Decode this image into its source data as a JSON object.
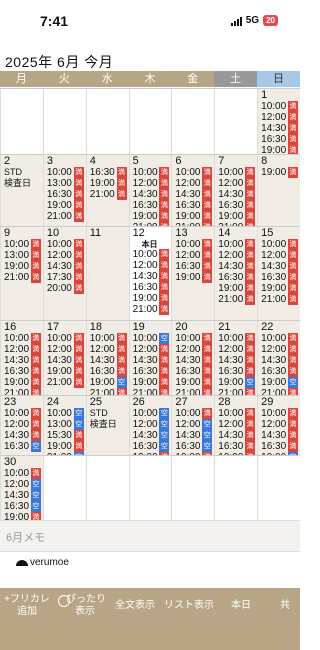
{
  "status_bar": {
    "time": "7:41",
    "network": "5G",
    "battery": "20"
  },
  "header": {
    "title": "2025年 6月 今月"
  },
  "weekdays": [
    "月",
    "火",
    "水",
    "木",
    "金",
    "土",
    "日"
  ],
  "badge_labels": {
    "red": "満",
    "blue": "空"
  },
  "today_label": "本日",
  "weeks": [
    [
      null,
      null,
      null,
      null,
      null,
      null,
      {
        "day": "1",
        "times": [
          "10:00",
          "12:00",
          "14:30",
          "16:30",
          "19:00",
          "21:00"
        ],
        "badges": [
          "red",
          "red",
          "red",
          "red",
          "red",
          "red"
        ]
      }
    ],
    [
      {
        "day": "2",
        "note": [
          "STD",
          "検査日"
        ],
        "times": [],
        "badges": []
      },
      {
        "day": "3",
        "times": [
          "10:00",
          "13:00",
          "16:30",
          "19:00",
          "21:00"
        ],
        "badges": [
          "red",
          "red",
          "red",
          "red",
          "red"
        ]
      },
      {
        "day": "4",
        "times": [
          "16:30",
          "19:00",
          "21:00"
        ],
        "badges": [
          "red",
          "red",
          "red"
        ]
      },
      {
        "day": "5",
        "times": [
          "10:00",
          "12:00",
          "14:30",
          "16:30",
          "19:00",
          "21:00"
        ],
        "badges": [
          "red",
          "red",
          "red",
          "red",
          "red",
          "red"
        ]
      },
      {
        "day": "6",
        "times": [
          "10:00",
          "12:00",
          "14:30",
          "16:30",
          "19:00",
          "21:00"
        ],
        "badges": [
          "red",
          "red",
          "red",
          "red",
          "red",
          "red"
        ]
      },
      {
        "day": "7",
        "times": [
          "10:00",
          "12:00",
          "14:30",
          "16:30",
          "19:00",
          "21:00"
        ],
        "badges": [
          "red",
          "red",
          "red",
          "red",
          "red",
          "red"
        ]
      },
      {
        "day": "8",
        "times": [
          "19:00"
        ],
        "badges": [
          "red"
        ]
      }
    ],
    [
      {
        "day": "9",
        "times": [
          "10:00",
          "13:00",
          "19:00",
          "21:00"
        ],
        "badges": [
          "red",
          "red",
          "red",
          "red"
        ]
      },
      {
        "day": "10",
        "times": [
          "10:00",
          "12:00",
          "14:30",
          "17:30",
          "20:00"
        ],
        "badges": [
          "red",
          "red",
          "red",
          "red",
          "red"
        ]
      },
      {
        "day": "11",
        "times": [],
        "badges": []
      },
      {
        "day": "12",
        "today": true,
        "times": [
          "10:00",
          "12:00",
          "14:30",
          "16:30",
          "19:00",
          "21:00"
        ],
        "badges": [
          "red",
          "red",
          "red",
          "red",
          "red",
          "red"
        ]
      },
      {
        "day": "13",
        "times": [
          "10:00",
          "12:00",
          "16:30",
          "19:00"
        ],
        "badges": [
          "red",
          "red",
          "red",
          "red"
        ]
      },
      {
        "day": "14",
        "times": [
          "10:00",
          "12:00",
          "14:30",
          "16:30",
          "19:00",
          "21:00"
        ],
        "badges": [
          "red",
          "red",
          "red",
          "red",
          "red",
          "red"
        ]
      },
      {
        "day": "15",
        "times": [
          "10:00",
          "12:00",
          "14:30",
          "16:30",
          "19:00",
          "21:00"
        ],
        "badges": [
          "red",
          "red",
          "red",
          "red",
          "red",
          "red"
        ]
      }
    ],
    [
      {
        "day": "16",
        "times": [
          "10:00",
          "12:00",
          "14:30",
          "16:30",
          "19:00",
          "21:00"
        ],
        "badges": [
          "red",
          "red",
          "red",
          "red",
          "red",
          "red"
        ]
      },
      {
        "day": "17",
        "times": [
          "10:00",
          "12:00",
          "14:30",
          "19:00",
          "21:00"
        ],
        "badges": [
          "red",
          "red",
          "red",
          "red",
          "red"
        ]
      },
      {
        "day": "18",
        "times": [
          "10:00",
          "12:00",
          "14:30",
          "16:30",
          "19:00",
          "21:00"
        ],
        "badges": [
          "red",
          "red",
          "red",
          "red",
          "blue",
          "red"
        ]
      },
      {
        "day": "19",
        "times": [
          "10:00",
          "12:00",
          "14:30",
          "16:30",
          "19:00",
          "21:00"
        ],
        "badges": [
          "blue",
          "red",
          "red",
          "red",
          "red",
          "red"
        ]
      },
      {
        "day": "20",
        "times": [
          "10:00",
          "12:00",
          "14:30",
          "16:30",
          "19:00",
          "21:00"
        ],
        "badges": [
          "red",
          "red",
          "red",
          "red",
          "red",
          "red"
        ]
      },
      {
        "day": "21",
        "times": [
          "10:00",
          "12:00",
          "14:30",
          "16:30",
          "19:00",
          "21:00"
        ],
        "badges": [
          "red",
          "red",
          "red",
          "red",
          "blue",
          "red"
        ]
      },
      {
        "day": "22",
        "times": [
          "10:00",
          "12:00",
          "14:30",
          "16:30",
          "19:00",
          "21:00"
        ],
        "badges": [
          "red",
          "red",
          "red",
          "red",
          "blue",
          "red"
        ]
      }
    ],
    [
      {
        "day": "23",
        "times": [
          "10:00",
          "12:00",
          "14:30",
          "16:30"
        ],
        "badges": [
          "red",
          "red",
          "red",
          "blue"
        ]
      },
      {
        "day": "24",
        "times": [
          "10:00",
          "13:00",
          "15:30",
          "19:00",
          "21:00"
        ],
        "badges": [
          "blue",
          "blue",
          "red",
          "red",
          "blue"
        ]
      },
      {
        "day": "25",
        "note": [
          "STD",
          "検査日"
        ],
        "times": [],
        "badges": []
      },
      {
        "day": "26",
        "times": [
          "10:00",
          "12:00",
          "14:30",
          "16:30",
          "19:00",
          "21:00"
        ],
        "badges": [
          "blue",
          "blue",
          "blue",
          "blue",
          "red",
          "red"
        ]
      },
      {
        "day": "27",
        "times": [
          "10:00",
          "12:00",
          "14:30",
          "16:30",
          "19:00",
          "21:00"
        ],
        "badges": [
          "red",
          "blue",
          "blue",
          "blue",
          "red",
          "red"
        ]
      },
      {
        "day": "28",
        "times": [
          "10:00",
          "12:00",
          "14:30",
          "16:30",
          "19:00",
          "21:00"
        ],
        "badges": [
          "red",
          "red",
          "red",
          "red",
          "red",
          "red"
        ]
      },
      {
        "day": "29",
        "times": [
          "10:00",
          "12:00",
          "14:30",
          "16:30",
          "19:00",
          "21:00"
        ],
        "badges": [
          "red",
          "red",
          "red",
          "red",
          "blue",
          "red"
        ]
      }
    ],
    [
      {
        "day": "30",
        "times": [
          "10:00",
          "12:00",
          "14:30",
          "16:30",
          "19:00",
          "21:00"
        ],
        "badges": [
          "red",
          "blue",
          "blue",
          "blue",
          "red",
          "blue"
        ]
      },
      null,
      null,
      null,
      null,
      null,
      null
    ]
  ],
  "memo": {
    "placeholder": "6月メモ"
  },
  "logo": {
    "text": "verumoe"
  },
  "toolbar": {
    "freecal_line1": "+フリカレ",
    "freecal_line2": "追加",
    "fit_line1": "ぴったり",
    "fit_line2": "表示",
    "fulltext": "全文表示",
    "list": "リスト表示",
    "today": "本日",
    "share": "共"
  }
}
